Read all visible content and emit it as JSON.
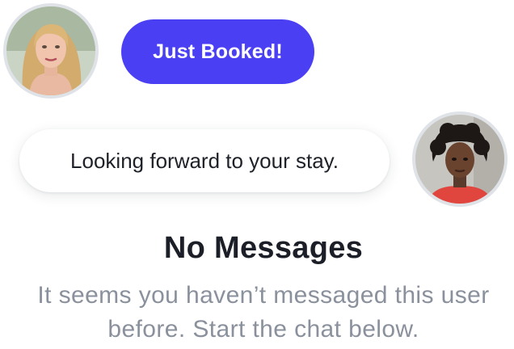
{
  "conversation": {
    "incoming": {
      "avatar_icon": "user-avatar-blonde-woman",
      "message": "Just Booked!",
      "bubble_color": "#4A3FF2"
    },
    "outgoing": {
      "avatar_icon": "user-avatar-curly-hair-woman",
      "message": "Looking forward to your stay."
    }
  },
  "empty_state": {
    "title": "No Messages",
    "description": "It seems you haven’t messaged this user before. Start the chat below."
  }
}
